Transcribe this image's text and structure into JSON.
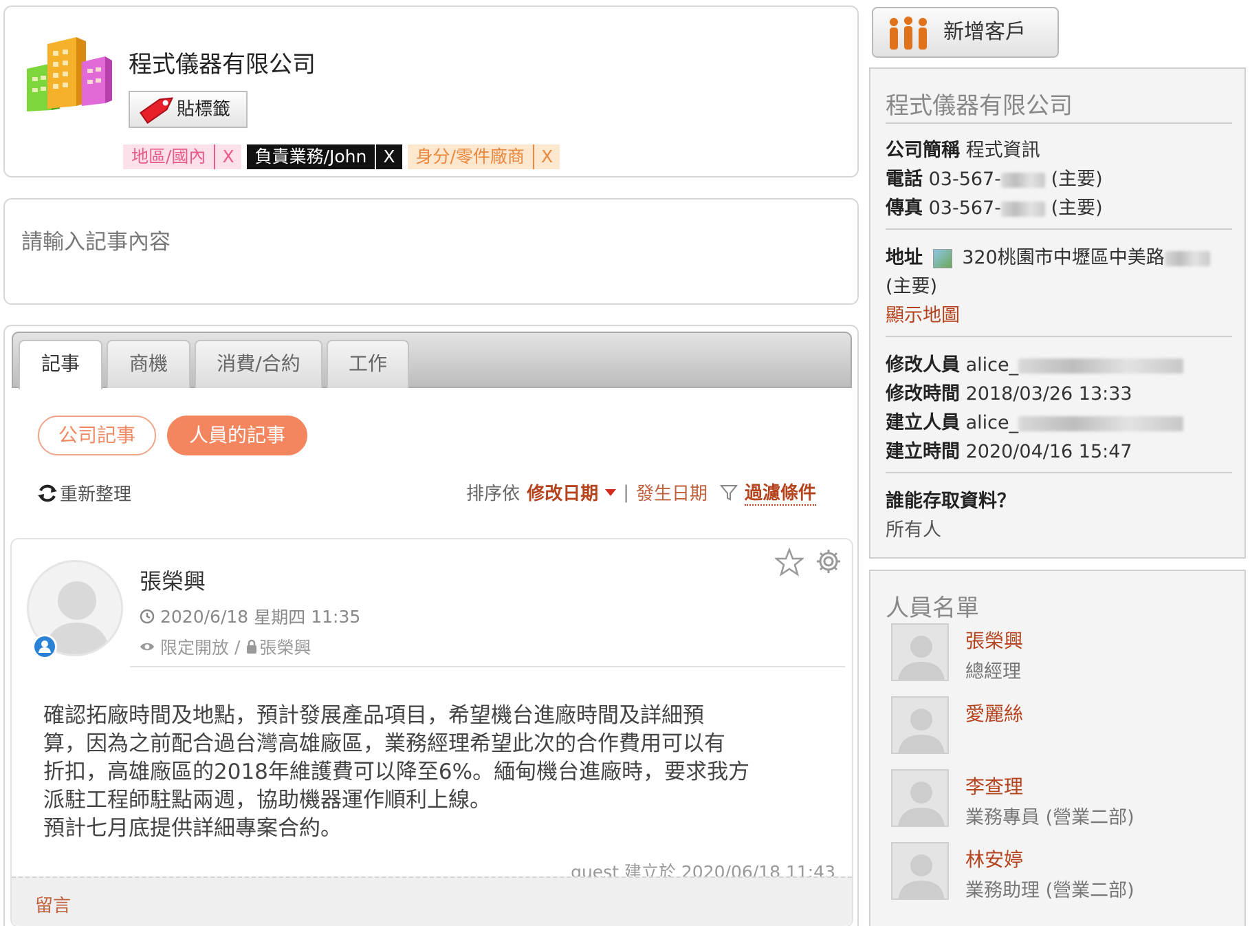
{
  "company": {
    "name": "程式儀器有限公司",
    "tag_button": "貼標籤",
    "tags": [
      {
        "label": "地區/國內",
        "remove": "X",
        "style": "pink"
      },
      {
        "label": "負責業務/John",
        "remove": "X",
        "style": "black"
      },
      {
        "label": "身分/零件廠商",
        "remove": "X",
        "style": "orange"
      }
    ]
  },
  "note_input": {
    "placeholder": "請輸入記事內容"
  },
  "tabs": [
    {
      "label": "記事",
      "active": true
    },
    {
      "label": "商機",
      "active": false
    },
    {
      "label": "消費/合約",
      "active": false
    },
    {
      "label": "工作",
      "active": false
    }
  ],
  "filters": {
    "company_notes": "公司記事",
    "staff_notes": "人員的記事"
  },
  "toolbar": {
    "refresh": "重新整理",
    "sort_prefix": "排序依",
    "sort_modified": "修改日期",
    "sort_sep": "|",
    "sort_occurred": "發生日期",
    "filter": "過濾條件"
  },
  "note": {
    "author": "張榮興",
    "date": "2020/6/18",
    "weekday": "星期四",
    "time": "11:35",
    "visibility": "限定開放",
    "vis_sep": "/",
    "owner": "張榮興",
    "body_lines": [
      "確認拓廠時間及地點，預計發展產品項目，希望機台進廠時間及詳細預",
      "算，因為之前配合過台灣高雄廠區，業務經理希望此次的合作費用可以有",
      "折扣，高雄廠區的2018年維護費可以降至6%。緬甸機台進廠時，要求我方",
      "派駐工程師駐點兩週，協助機器運作順利上線。",
      "預計七月底提供詳細專案合約。"
    ],
    "footer_user": "guest",
    "footer_text": "建立於 2020/06/18 11:43",
    "comment": "留言"
  },
  "sidebar": {
    "add_button": "新增客戶",
    "info": {
      "title": "程式儀器有限公司",
      "short_name_label": "公司簡稱",
      "short_name": "程式資訊",
      "phone_label": "電話",
      "phone": "03-567-",
      "phone_tag": "(主要)",
      "fax_label": "傳真",
      "fax": "03-567-",
      "fax_tag": "(主要)",
      "address_label": "地址",
      "address": "320桃園市中壢區中美路",
      "address_tag": "(主要)",
      "show_map": "顯示地圖",
      "modified_by_label": "修改人員",
      "modified_by": "alice_",
      "modified_time_label": "修改時間",
      "modified_time": "2018/03/26 13:33",
      "created_by_label": "建立人員",
      "created_by": "alice_",
      "created_time_label": "建立時間",
      "created_time": "2020/04/16 15:47",
      "access_label": "誰能存取資料？",
      "access_value": "所有人"
    },
    "staff": {
      "title": "人員名單",
      "people": [
        {
          "name": "張榮興",
          "title": "總經理"
        },
        {
          "name": "愛麗絲",
          "title": ""
        },
        {
          "name": "李查理",
          "title": "業務專員 (營業二部)"
        },
        {
          "name": "林安婷",
          "title": "業務助理 (營業二部)"
        }
      ]
    }
  }
}
